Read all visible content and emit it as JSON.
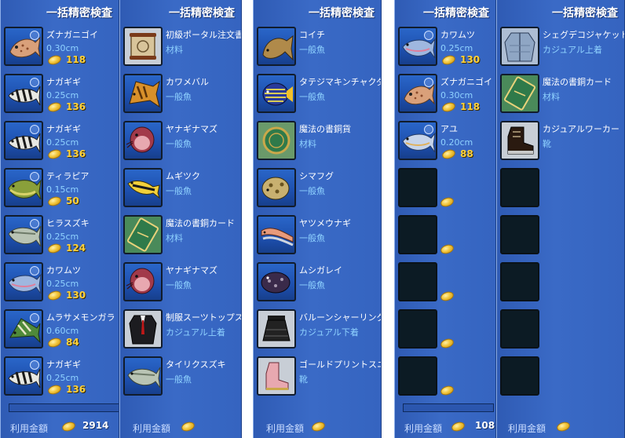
{
  "panels": [
    {
      "title": "一括精密検査",
      "items": [
        {
          "name": "ズナガニゴイ",
          "size": "0.30cm",
          "price": "118",
          "icon": "fish-spotted-icon"
        },
        {
          "name": "ナガギギ",
          "size": "0.25cm",
          "price": "136",
          "icon": "fish-catfish-icon"
        },
        {
          "name": "ナガギギ",
          "size": "0.25cm",
          "price": "136",
          "icon": "fish-catfish-icon"
        },
        {
          "name": "ティラピア",
          "size": "0.15cm",
          "price": "50",
          "icon": "fish-green-icon"
        },
        {
          "name": "ヒラスズキ",
          "size": "0.25cm",
          "price": "124",
          "icon": "fish-silver-icon"
        },
        {
          "name": "カワムツ",
          "size": "0.25cm",
          "price": "130",
          "icon": "fish-blue-icon"
        },
        {
          "name": "ムラサメモンガラ",
          "size": "0.60cm",
          "price": "84",
          "icon": "fish-trigger-icon"
        },
        {
          "name": "ナガギギ",
          "size": "0.25cm",
          "price": "136",
          "icon": "fish-catfish-icon"
        }
      ],
      "footer": {
        "label": "利用金額",
        "amount": "2914"
      }
    },
    {
      "title": "一括精密検査",
      "items": [
        {
          "name": "初級ポータル注文書",
          "category": "材料",
          "icon": "scroll-icon"
        },
        {
          "name": "カワメバル",
          "category": "一般魚",
          "icon": "fish-orange-icon"
        },
        {
          "name": "ヤナギナマズ",
          "category": "一般魚",
          "icon": "fish-catfish-red-icon"
        },
        {
          "name": "ムギツク",
          "category": "一般魚",
          "icon": "fish-yellow-icon"
        },
        {
          "name": "魔法の書銅カード",
          "category": "材料",
          "icon": "card-icon"
        },
        {
          "name": "ヤナギナマズ",
          "category": "一般魚",
          "icon": "fish-catfish-red-icon"
        },
        {
          "name": "制服スーツトップス",
          "category": "カジュアル上着",
          "icon": "suit-top-icon"
        },
        {
          "name": "タイリクスズキ",
          "category": "一般魚",
          "icon": "fish-silver-icon"
        }
      ],
      "footer": {
        "label": "利用金額",
        "amount": ""
      }
    },
    {
      "title": "一括精密検査",
      "items": [
        {
          "name": "コイチ",
          "category": "一般魚",
          "icon": "fish-brown-icon"
        },
        {
          "name": "タテジマキンチャクダイ",
          "category": "一般魚",
          "icon": "fish-angel-icon"
        },
        {
          "name": "魔法の書銅貨",
          "category": "材料",
          "icon": "coin-item-icon"
        },
        {
          "name": "シマフグ",
          "category": "一般魚",
          "icon": "fish-puffer-icon"
        },
        {
          "name": "ヤツメウナギ",
          "category": "一般魚",
          "icon": "fish-eel-icon"
        },
        {
          "name": "ムシガレイ",
          "category": "一般魚",
          "icon": "fish-flounder-icon"
        },
        {
          "name": "バルーンシャーリングスカート",
          "category": "カジュアル下着",
          "icon": "skirt-icon"
        },
        {
          "name": "ゴールドプリントスニーカー",
          "category": "靴",
          "icon": "sneaker-icon"
        }
      ],
      "footer": {
        "label": "利用金額",
        "amount": ""
      }
    },
    {
      "title": "一括精密検査",
      "items": [
        {
          "name": "カワムツ",
          "size": "0.25cm",
          "price": "130",
          "icon": "fish-blue-icon"
        },
        {
          "name": "ズナガニゴイ",
          "size": "0.30cm",
          "price": "118",
          "icon": "fish-spotted-icon"
        },
        {
          "name": "アユ",
          "size": "0.20cm",
          "price": "88",
          "icon": "fish-blue-icon"
        }
      ],
      "empty_slots": 5,
      "footer": {
        "label": "利用金額",
        "amount": "108"
      }
    },
    {
      "title": "一括精密検査",
      "items": [
        {
          "name": "シェグデコジャケット",
          "category": "カジュアル上着",
          "icon": "jacket-icon"
        },
        {
          "name": "魔法の書銅カード",
          "category": "材料",
          "icon": "card-icon"
        },
        {
          "name": "カジュアルワーカー",
          "category": "靴",
          "icon": "boot-icon"
        }
      ],
      "empty_slots": 5,
      "footer": {
        "label": "利用金額",
        "amount": ""
      }
    }
  ],
  "progress": {
    "panel_1": 0.0,
    "panel_4": 0.0
  }
}
